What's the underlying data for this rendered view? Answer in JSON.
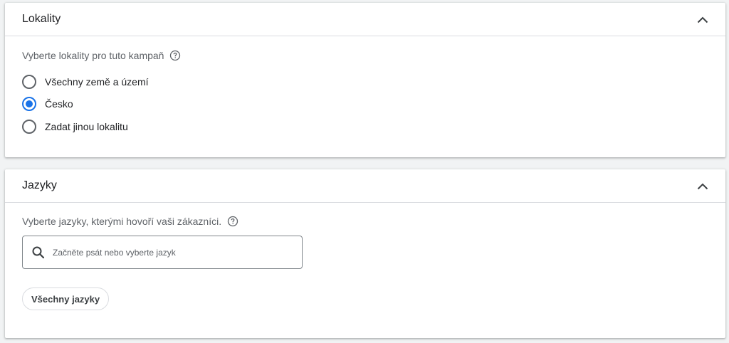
{
  "locations": {
    "title": "Lokality",
    "prompt": "Vyberte lokality pro tuto kampaň",
    "options": [
      {
        "label": "Všechny země a území",
        "selected": false
      },
      {
        "label": "Česko",
        "selected": true
      },
      {
        "label": "Zadat jinou lokalitu",
        "selected": false
      }
    ]
  },
  "languages": {
    "title": "Jazyky",
    "prompt": "Vyberte jazyky, kterými hovoří vaši zákazníci.",
    "search_placeholder": "Začněte psát nebo vyberte jazyk",
    "chips": [
      "Všechny jazyky"
    ]
  },
  "colors": {
    "accent": "#1a73e8",
    "text": "#202124",
    "secondary_text": "#5f6368",
    "divider": "#dadce0",
    "background": "#f1f3f4"
  },
  "icons": {
    "collapse": "chevron-up-icon",
    "help": "help-circle-icon",
    "search": "search-icon"
  }
}
